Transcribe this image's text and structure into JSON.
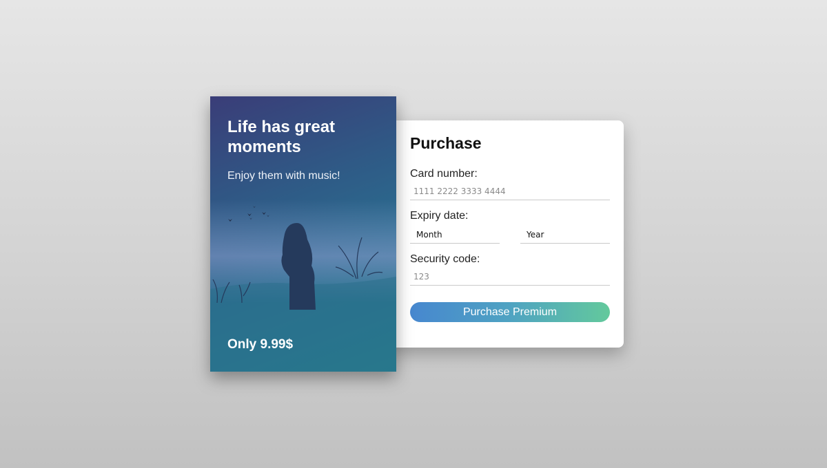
{
  "promo": {
    "title": "Life has great moments",
    "subtitle": "Enjoy them with music!",
    "price": "Only 9.99$"
  },
  "form": {
    "title": "Purchase",
    "card_number": {
      "label": "Card number:",
      "placeholder": "1111 2222 3333 4444"
    },
    "expiry": {
      "label": "Expiry date:",
      "month": "Month",
      "year": "Year"
    },
    "security": {
      "label": "Security code:",
      "placeholder": "123"
    },
    "button_label": "Purchase Premium"
  },
  "colors": {
    "button_gradient_start": "#4787cf",
    "button_gradient_end": "#63c99c",
    "promo_top": "#3a3d78",
    "promo_bottom": "#23828d"
  }
}
